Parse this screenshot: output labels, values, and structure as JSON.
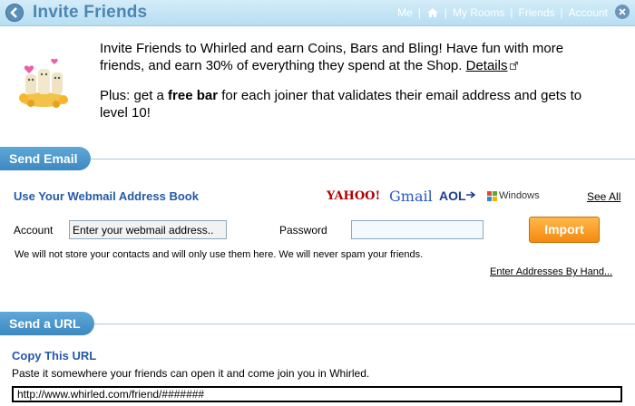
{
  "header": {
    "title": "Invite Friends",
    "nav": [
      "Me",
      "My Rooms",
      "Friends",
      "Account"
    ]
  },
  "intro": {
    "line1": "Invite Friends to Whirled and earn Coins, Bars and Bling! Have fun with more friends, and earn 30% of everything they spend at the Shop.",
    "details_link": "Details",
    "plus_prefix": "Plus: get a ",
    "plus_bold": "free bar",
    "plus_suffix": " for each joiner that validates their email address and gets to level 10!"
  },
  "send_email": {
    "tab_label": "Send Email",
    "heading": "Use Your Webmail Address Book",
    "providers": [
      "YAHOO!",
      "Gmail",
      "AOL",
      "Windows"
    ],
    "see_all": "See All",
    "account_label": "Account",
    "account_value": "Enter your webmail address..",
    "password_label": "Password",
    "import_label": "Import",
    "note": "We will not store your contacts and will only use them here. We will never spam your friends.",
    "hand_link": "Enter Addresses By Hand..."
  },
  "send_url": {
    "tab_label": "Send a URL",
    "heading": "Copy This URL",
    "description": "Paste it somewhere your friends can open it and come join you in Whirled.",
    "url_value": "http://www.whirled.com/friend/#######"
  },
  "colors": {
    "accent_blue": "#2459a8",
    "tab_blue": "#3c88c2",
    "import_orange": "#f48a10"
  }
}
